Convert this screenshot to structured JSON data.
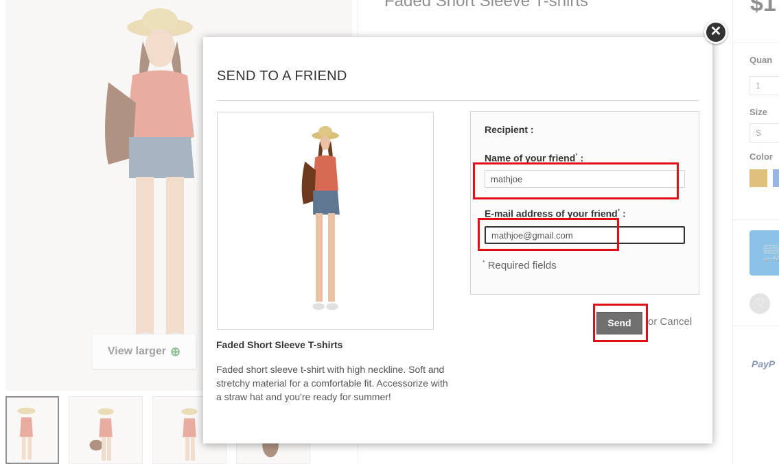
{
  "background": {
    "product_title": "Faded Short Sleeve T-shirts",
    "price": "$1",
    "view_larger": "View larger",
    "quantity_label": "Quan",
    "quantity_value": "1",
    "size_label": "Size",
    "size_value": "S",
    "color_label": "Color",
    "paypal_text": "PayP",
    "swatch_colors": [
      "#c98a12",
      "#4a78c8"
    ]
  },
  "modal": {
    "title": "SEND TO A FRIEND",
    "close_icon": "close-icon",
    "product": {
      "name": "Faded Short Sleeve T-shirts",
      "description": "Faded short sleeve t-shirt with high neckline. Soft and stretchy material for a comfortable fit. Accessorize with a straw hat and you're ready for summer!"
    },
    "form": {
      "recipient_heading": "Recipient :",
      "name_label": "Name of your friend",
      "name_value": "mathjoe",
      "email_label": "E-mail address of your friend",
      "email_value": "mathjoe@gmail.com",
      "required_mark": "*",
      "label_colon": " :",
      "required_note": "Required fields"
    },
    "send_label": "Send",
    "or_label": "or",
    "cancel_label": "Cancel"
  },
  "colors": {
    "highlight": "#e10f14",
    "send_button": "#707070",
    "cart_button": "#2e8fd6"
  }
}
